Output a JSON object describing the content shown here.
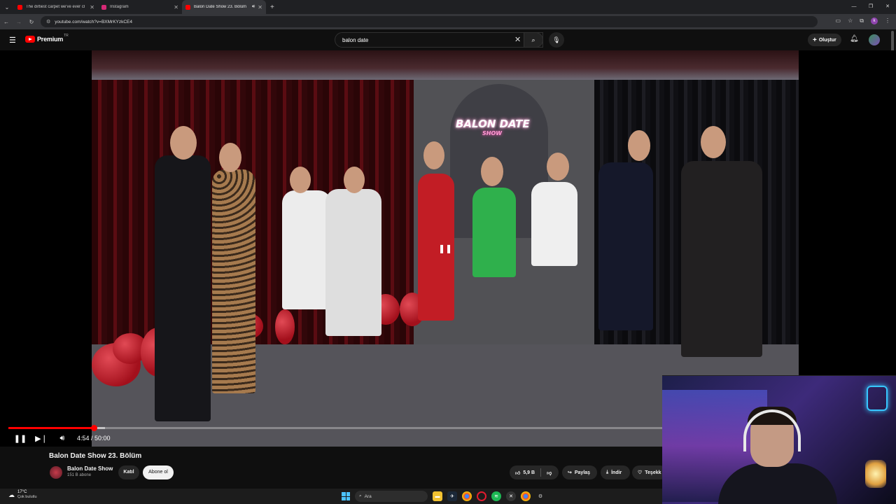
{
  "browser": {
    "tabs": [
      {
        "title": "The dirtiest carpet we've ever cl",
        "favicon_color": "#ff0000",
        "active": false
      },
      {
        "title": "Instagram",
        "favicon_color": "#d62976",
        "active": false
      },
      {
        "title": "Balon Date Show 23. Bölüm",
        "favicon_color": "#ff0000",
        "active": true
      }
    ],
    "new_tab": "+",
    "url": "youtube.com/watch?v=BXMrKYzkCE4"
  },
  "youtube": {
    "logo_text": "Premium",
    "region": "TR",
    "search_value": "balon date",
    "create_label": "Oluştur"
  },
  "video": {
    "progress": 0.0975,
    "buffered": 0.11,
    "neon_title": "BALON DATE",
    "neon_sub": "SHOW"
  },
  "player": {
    "time": "4:54 / 50:00"
  },
  "info": {
    "title": "Balon Date Show 23. Bölüm",
    "channel": "Balon Date Show",
    "subscribers": "151 B abone",
    "join_label": "Katıl",
    "subscribe_label": "Abone ol",
    "likes": "5,9 B",
    "share_label": "Paylaş",
    "download_label": "İndir",
    "thanks_label": "Teşekk"
  },
  "taskbar": {
    "temperature": "17°C",
    "weather": "Çok bulutlu",
    "search_placeholder": "Ara"
  },
  "colors": {
    "accent": "#ff0000",
    "background": "#0f0f0f"
  }
}
